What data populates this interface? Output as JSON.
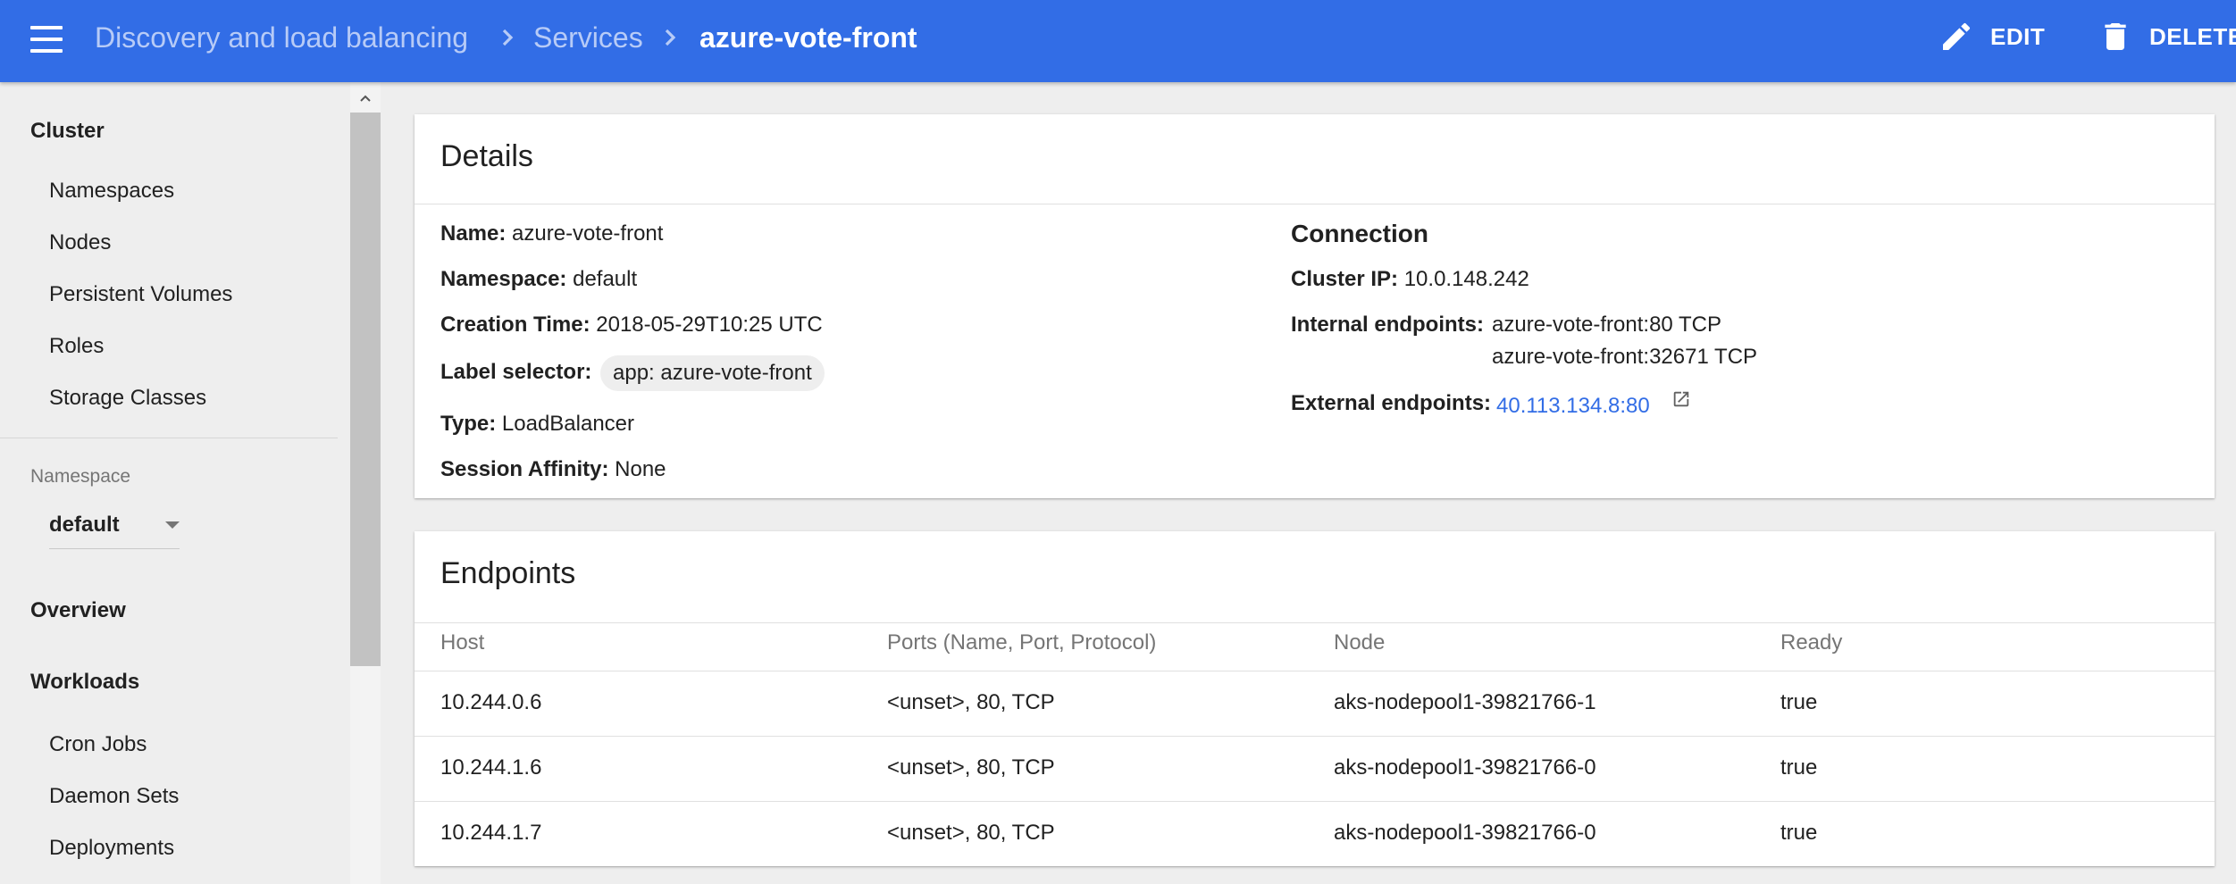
{
  "header": {
    "breadcrumbs": [
      "Discovery and load balancing",
      "Services",
      "azure-vote-front"
    ],
    "edit_label": "EDIT",
    "delete_label": "DELETE"
  },
  "sidebar": {
    "cluster_heading": "Cluster",
    "cluster_items": [
      "Namespaces",
      "Nodes",
      "Persistent Volumes",
      "Roles",
      "Storage Classes"
    ],
    "namespace_label": "Namespace",
    "namespace_value": "default",
    "overview_label": "Overview",
    "workloads_heading": "Workloads",
    "workload_items": [
      "Cron Jobs",
      "Daemon Sets",
      "Deployments"
    ]
  },
  "details": {
    "title": "Details",
    "name_label": "Name:",
    "name_value": "azure-vote-front",
    "namespace_label": "Namespace:",
    "namespace_value": "default",
    "creation_label": "Creation Time:",
    "creation_value": "2018-05-29T10:25 UTC",
    "selector_label": "Label selector:",
    "selector_value": "app: azure-vote-front",
    "type_label": "Type:",
    "type_value": "LoadBalancer",
    "affinity_label": "Session Affinity:",
    "affinity_value": "None",
    "connection": {
      "heading": "Connection",
      "cluster_ip_label": "Cluster IP:",
      "cluster_ip_value": "10.0.148.242",
      "internal_label": "Internal endpoints:",
      "internal_values": [
        "azure-vote-front:80 TCP",
        "azure-vote-front:32671 TCP"
      ],
      "external_label": "External endpoints:",
      "external_value": "40.113.134.8:80"
    }
  },
  "endpoints": {
    "title": "Endpoints",
    "columns": [
      "Host",
      "Ports (Name, Port, Protocol)",
      "Node",
      "Ready"
    ],
    "rows": [
      [
        "10.244.0.6",
        "<unset>, 80, TCP",
        "aks-nodepool1-39821766-1",
        "true"
      ],
      [
        "10.244.1.6",
        "<unset>, 80, TCP",
        "aks-nodepool1-39821766-0",
        "true"
      ],
      [
        "10.244.1.7",
        "<unset>, 80, TCP",
        "aks-nodepool1-39821766-0",
        "true"
      ]
    ]
  },
  "colors": {
    "primary": "#326de6",
    "background": "#eeeeee",
    "card": "#ffffff",
    "link": "#326de6"
  },
  "icons": [
    "menu-icon",
    "chevron-right-icon",
    "pencil-icon",
    "trash-icon",
    "chevron-up-icon",
    "dropdown-arrow-icon",
    "open-in-new-icon"
  ]
}
